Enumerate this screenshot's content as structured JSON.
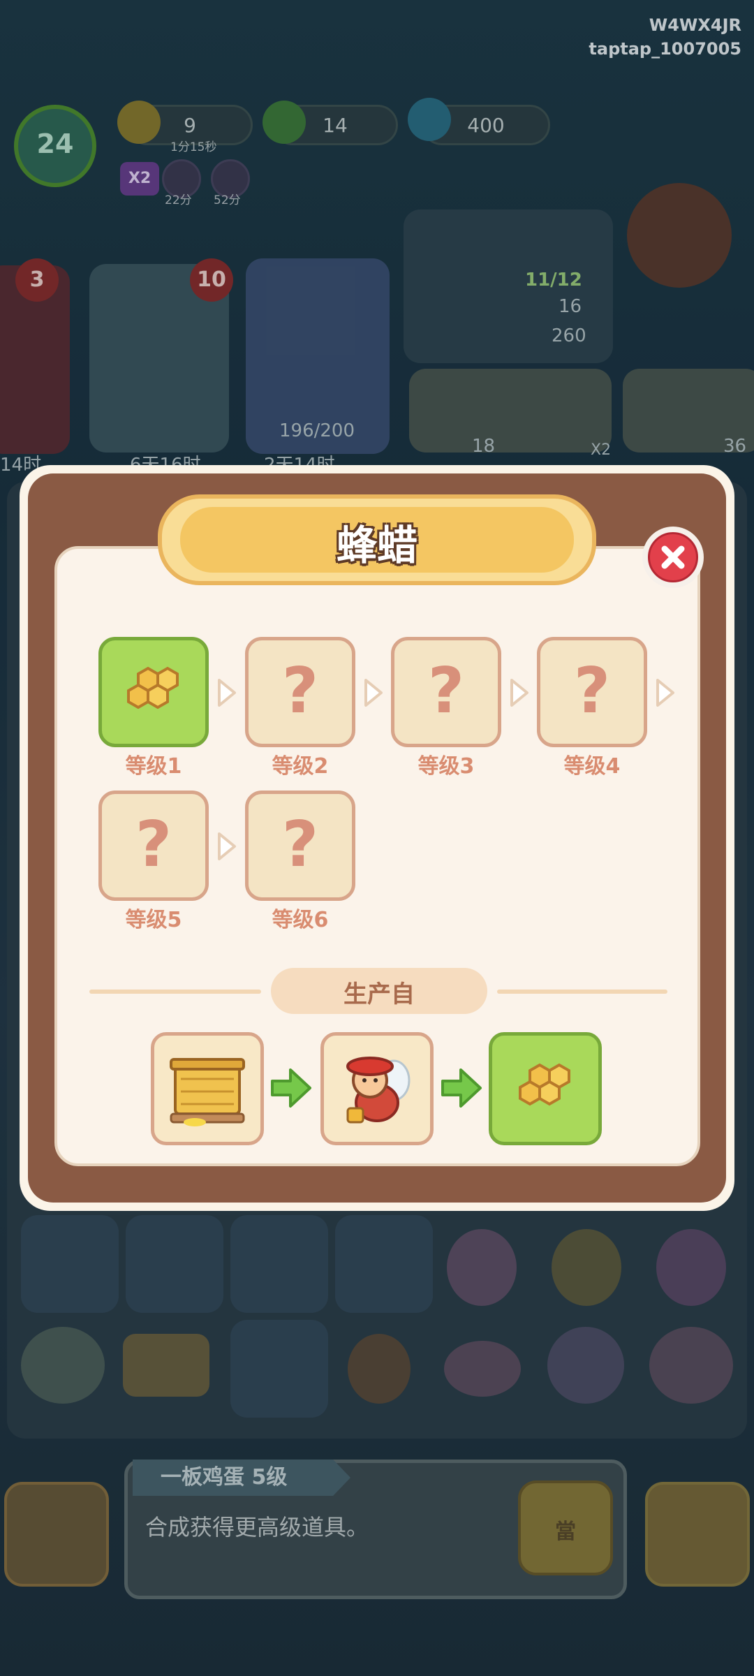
{
  "watermark": {
    "code": "W4WX4JR",
    "user": "taptap_1007005"
  },
  "hud": {
    "player_level": "24",
    "energy": {
      "value": "9",
      "timer": "1分15秒"
    },
    "gems": {
      "value": "14"
    },
    "flames": {
      "value": "400"
    },
    "boost_multiplier": "X2",
    "boost_timer_1": "22分",
    "boost_timer_2": "52分"
  },
  "background": {
    "card_badge_1": "3",
    "card_badge_2": "10",
    "card_progress": "196/200",
    "timer_left": "14时",
    "timer_mid_1": "6天16时",
    "timer_mid_2": "2天14时",
    "stat_fraction": "11/12",
    "stat_a": "16",
    "stat_b": "260",
    "price_1": "18",
    "price_2": "36",
    "x2_tag": "X2"
  },
  "tip": {
    "tag": "一板鸡蛋 5级",
    "text": "合成获得更高级道具。",
    "bag_label": "當"
  },
  "modal": {
    "title": "蜂蜡",
    "levels": [
      {
        "label": "等级1",
        "unlocked": true
      },
      {
        "label": "等级2",
        "unlocked": false,
        "placeholder": "?"
      },
      {
        "label": "等级3",
        "unlocked": false,
        "placeholder": "?"
      },
      {
        "label": "等级4",
        "unlocked": false,
        "placeholder": "?"
      },
      {
        "label": "等级5",
        "unlocked": false,
        "placeholder": "?"
      },
      {
        "label": "等级6",
        "unlocked": false,
        "placeholder": "?"
      }
    ],
    "produced_from_heading": "生产自",
    "production_chain": [
      "beehive-icon",
      "bee-worker-icon",
      "beeswax-icon"
    ]
  },
  "colors": {
    "frame_brown": "#8a5a44",
    "banner_gold": "#f4c662",
    "tile_active_green": "#a9d95a",
    "tile_locked": "#f4e4c4",
    "label_orange": "#d98c70",
    "close_red": "#e2404b"
  }
}
